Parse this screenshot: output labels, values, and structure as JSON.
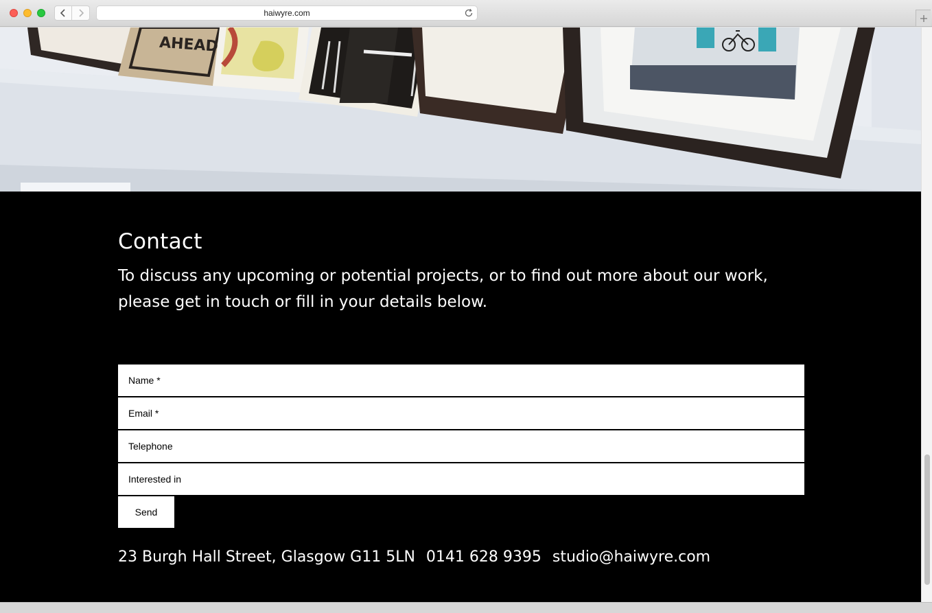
{
  "browser": {
    "url": "haiwyre.com"
  },
  "hero": {
    "print_text": "AHEAD",
    "colors": {
      "shelf": "#dfe4ea",
      "wall": "#eef1f5",
      "frame": "#2e2522",
      "mat": "#f3f3f0",
      "kraft": "#c9b699",
      "door_teal": "#3aa7b6"
    }
  },
  "contact": {
    "title": "Contact",
    "intro": "To discuss any upcoming or potential projects, or to find out more about our work, please get in touch or fill in your details below.",
    "form": {
      "name_placeholder": "Name *",
      "email_placeholder": "Email *",
      "telephone_placeholder": "Telephone",
      "interest_placeholder": "Interested in",
      "send_label": "Send"
    },
    "footer": {
      "address": "23 Burgh Hall Street, Glasgow G11 5LN",
      "phone": "0141 628 9395",
      "email": "studio@haiwyre.com"
    }
  },
  "icons": [
    "close-icon",
    "minimize-icon",
    "maximize-icon",
    "chevron-left-icon",
    "chevron-right-icon",
    "reload-icon",
    "plus-icon"
  ]
}
